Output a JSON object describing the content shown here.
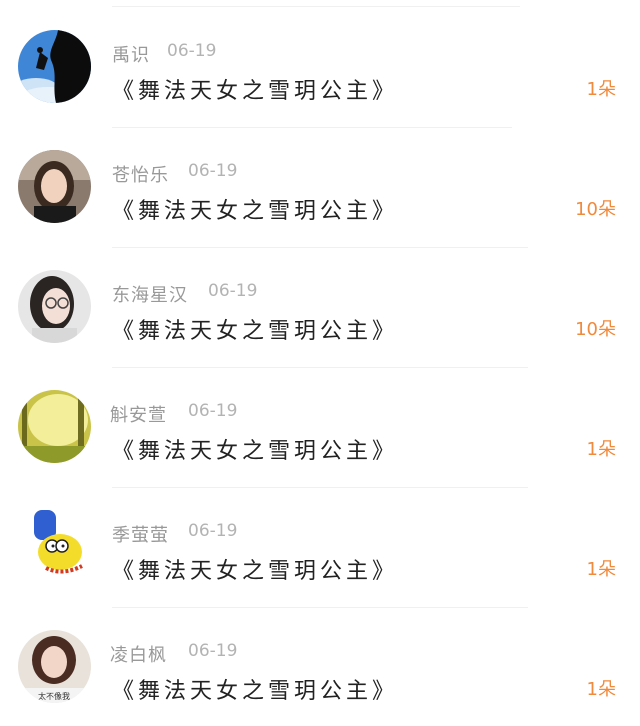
{
  "list": {
    "items": [
      {
        "name": "禹识",
        "date": "06-19",
        "message": "《舞法天女之雪玥公主》",
        "amount": "1朵",
        "avatar": "silhouette-climber-avatar"
      },
      {
        "name": "苍怡乐",
        "date": "06-19",
        "message": "《舞法天女之雪玥公主》",
        "amount": "10朵",
        "avatar": "woman-portrait-avatar"
      },
      {
        "name": "东海星汉",
        "date": "06-19",
        "message": "《舞法天女之雪玥公主》",
        "amount": "10朵",
        "avatar": "glasses-girl-avatar"
      },
      {
        "name": "斛安萱",
        "date": "06-19",
        "message": "《舞法天女之雪玥公主》",
        "amount": "1朵",
        "avatar": "forest-scene-avatar"
      },
      {
        "name": "季萤萤",
        "date": "06-19",
        "message": "《舞法天女之雪玥公主》",
        "amount": "1朵",
        "avatar": "cartoon-character-avatar"
      },
      {
        "name": "凌白枫",
        "date": "06-19",
        "message": "《舞法天女之雪玥公主》",
        "amount": "1朵",
        "avatar": "girl-photo-avatar",
        "avatar_caption": "太不像我"
      }
    ]
  },
  "colors": {
    "name": "#999999",
    "date": "#b3b3b3",
    "message": "#222222",
    "amount": "#f08a3c",
    "divider": "#f0f0f0"
  }
}
